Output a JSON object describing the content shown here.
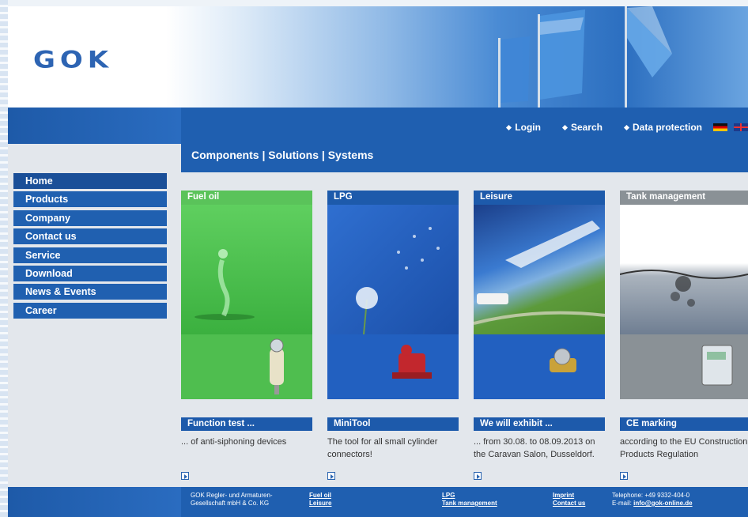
{
  "logo": "GOK",
  "toplinks": [
    {
      "label": "Login"
    },
    {
      "label": "Search"
    },
    {
      "label": "Data protection"
    }
  ],
  "tagline": "Components | Solutions | Systems",
  "nav": [
    "Home",
    "Products",
    "Company",
    "Contact us",
    "Service",
    "Download",
    "News & Events",
    "Career"
  ],
  "columns": [
    {
      "head": "Fuel oil",
      "news_head": "Function test ...",
      "news_text": "... of anti-siphoning devices"
    },
    {
      "head": "LPG",
      "news_head": "MiniTool",
      "news_text": "The tool for all small cylinder connectors!"
    },
    {
      "head": "Leisure",
      "news_head": "We will exhibit ...",
      "news_text": "... from 30.08. to 08.09.2013 on the Caravan Salon, Dusseldorf."
    },
    {
      "head": "Tank management",
      "news_head": "CE marking",
      "news_text": "according to the EU Construction Products Regulation"
    }
  ],
  "footer": {
    "company_line1": "GOK Regler- und Armaturen-",
    "company_line2": "Gesellschaft mbH & Co. KG",
    "links": [
      "Fuel oil",
      "Leisure",
      "LPG",
      "Tank management",
      "Imprint",
      "Contact us"
    ],
    "telephone": "Telephone: +49 9332-404-0",
    "email_label": "E-mail: ",
    "email": "info@gok-online.de"
  },
  "colors": {
    "brand_blue": "#1f5fb0",
    "fuel_green": "#5ac35a",
    "tank_grey": "#8a9196"
  }
}
